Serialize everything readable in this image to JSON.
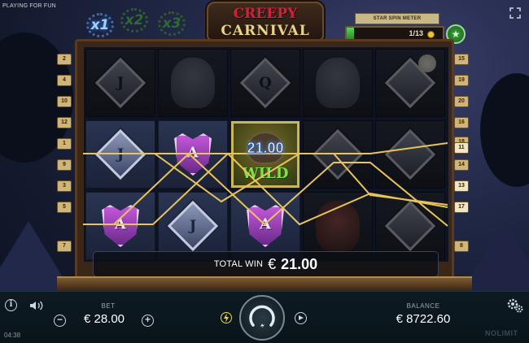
{
  "header": {
    "mode_label": "PLAYING FOR FUN",
    "logo_line1": "CREEPY",
    "logo_line2": "CARNIVAL"
  },
  "multipliers": [
    {
      "label": "x1",
      "active": true
    },
    {
      "label": "x2",
      "active": false
    },
    {
      "label": "x3",
      "active": false
    }
  ],
  "star_spin_meter": {
    "title": "STAR SPIN METER",
    "value": "1/13",
    "progress": 0.077,
    "accent": "#3fbf3f"
  },
  "reels": {
    "columns": [
      [
        "diamond-j",
        "diamond-a-purple-blank",
        "tulip-a"
      ],
      [
        "character-jester",
        "tulip-a",
        "diamond-j"
      ],
      [
        "diamond-q",
        "wild",
        "tulip-a"
      ],
      [
        "character-strongman",
        "diamond-blank",
        "character-clown"
      ],
      [
        "diamond-blank-moon",
        "diamond-blank",
        "diamond-blank"
      ]
    ],
    "letters": {
      "r0c0": "J",
      "r0c2": "Q",
      "r1c0": "J",
      "r1c1": "A",
      "r2c0": "A",
      "r2c1": "J",
      "r2c2": "A"
    },
    "wild_label": "WILD"
  },
  "win_amount_on_reel": "21.00",
  "paylines": {
    "left": [
      "2",
      "4",
      "10",
      "12",
      "1",
      "9",
      "3",
      "5",
      "7"
    ],
    "right": [
      "15",
      "19",
      "20",
      "16",
      "18",
      "11",
      "14",
      "13",
      "17",
      "8"
    ],
    "winning_color": "#e8c45a"
  },
  "total_win": {
    "label": "TOTAL WIN",
    "currency": "€",
    "value": "21.00"
  },
  "footer": {
    "bet_label": "BET",
    "bet_value": "€ 28.00",
    "minus": "−",
    "plus": "+",
    "balance_label": "BALANCE",
    "balance_value": "€ 8722.60",
    "clock": "04:38",
    "brand": "NOLIMIT",
    "info": "i",
    "icons": [
      "info-icon",
      "sound-icon",
      "bolt-icon",
      "spin-icon",
      "autoplay-icon",
      "settings-icon",
      "fullscreen-icon"
    ]
  }
}
